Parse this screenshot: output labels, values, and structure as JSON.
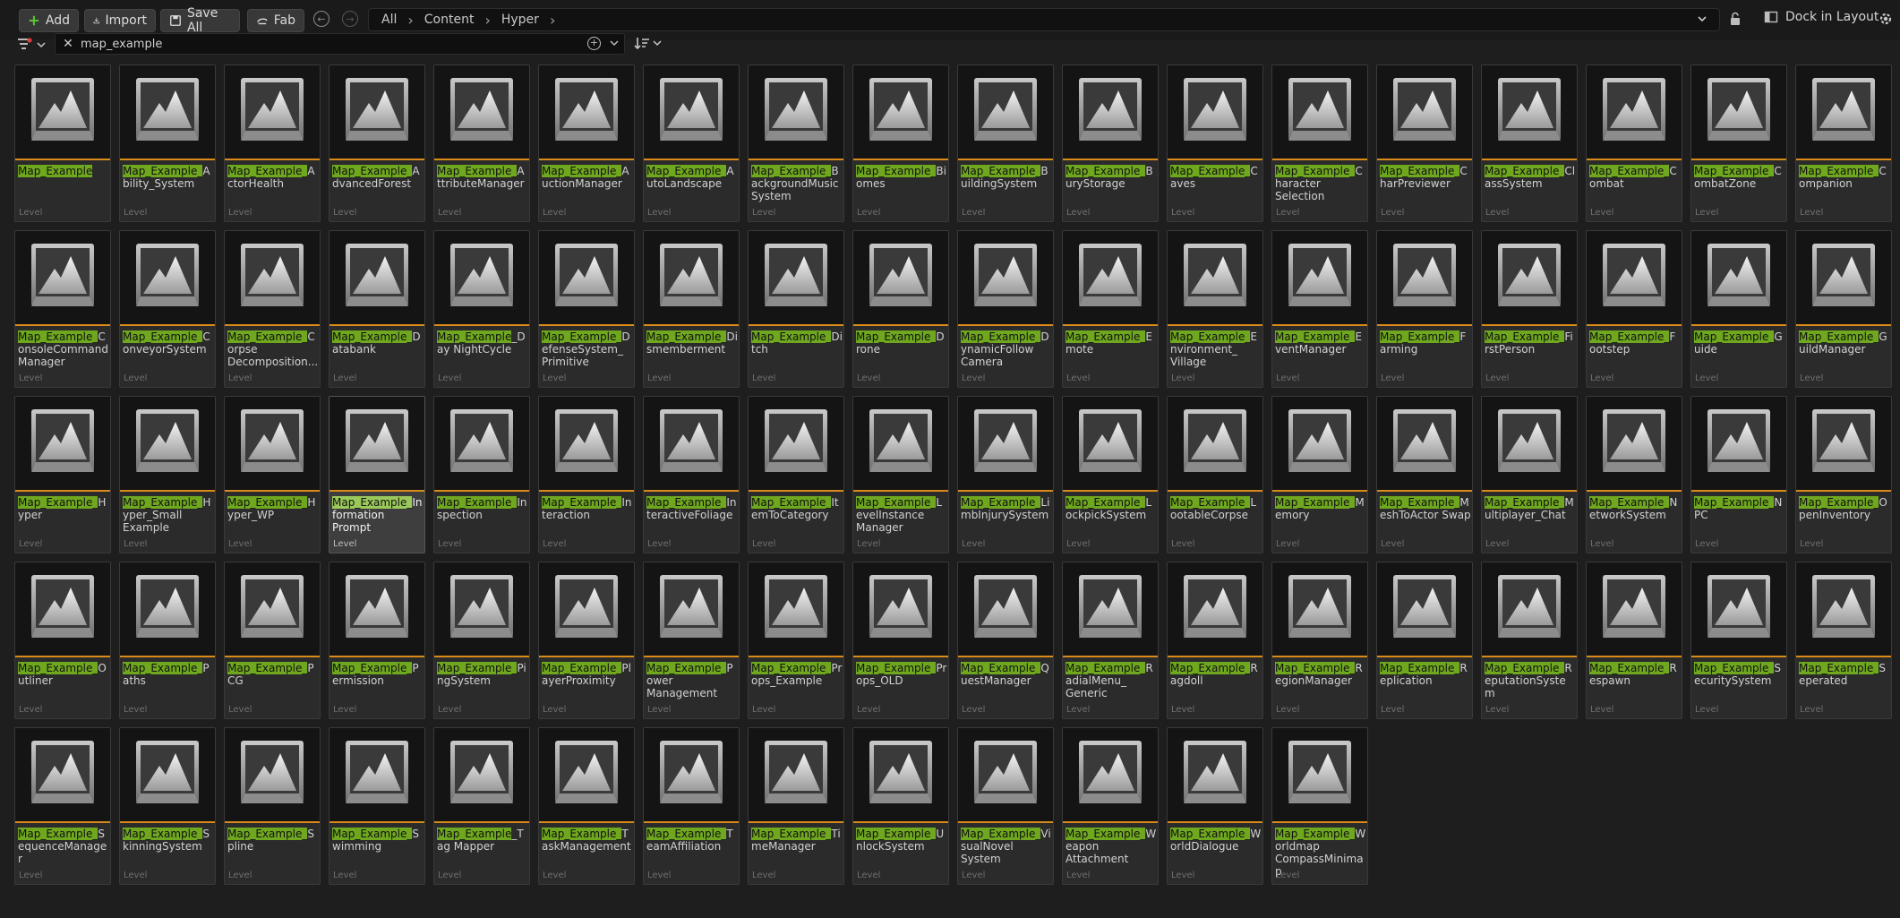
{
  "toolbar": {
    "add_label": "Add",
    "import_label": "Import",
    "save_all_label": "Save All",
    "fab_label": "Fab",
    "dock_label": "Dock in Layout"
  },
  "breadcrumb": [
    "All",
    "Content",
    "Hyper"
  ],
  "search": {
    "value": "map_example"
  },
  "highlight_color": "#6fa81f",
  "thumbnail_underline_color": "#d98a18",
  "assets": [
    {
      "hl": "Map_Example",
      "rest": "",
      "type": "Level"
    },
    {
      "hl": "Map_Example_",
      "rest": "Ability_System",
      "type": "Level"
    },
    {
      "hl": "Map_Example_",
      "rest": "ActorHealth",
      "type": "Level"
    },
    {
      "hl": "Map_Example_",
      "rest": "AdvancedForest",
      "type": "Level"
    },
    {
      "hl": "Map_Example_",
      "rest": "AttributeManager",
      "type": "Level"
    },
    {
      "hl": "Map_Example_",
      "rest": "AuctionManager",
      "type": "Level"
    },
    {
      "hl": "Map_Example_",
      "rest": "AutoLandscape",
      "type": "Level"
    },
    {
      "hl": "Map_Example_",
      "rest": "BackgroundMusic System",
      "type": "Level"
    },
    {
      "hl": "Map_Example_",
      "rest": "Biomes",
      "type": "Level"
    },
    {
      "hl": "Map_Example_",
      "rest": "BuildingSystem",
      "type": "Level"
    },
    {
      "hl": "Map_Example_",
      "rest": "BuryStorage",
      "type": "Level"
    },
    {
      "hl": "Map_Example_",
      "rest": "Caves",
      "type": "Level"
    },
    {
      "hl": "Map_Example_",
      "rest": "Character Selection",
      "type": "Level"
    },
    {
      "hl": "Map_Example_",
      "rest": "CharPreviewer",
      "type": "Level"
    },
    {
      "hl": "Map_Example_",
      "rest": "ClassSystem",
      "type": "Level"
    },
    {
      "hl": "Map_Example_",
      "rest": "Combat",
      "type": "Level"
    },
    {
      "hl": "Map_Example_",
      "rest": "CombatZone",
      "type": "Level"
    },
    {
      "hl": "Map_Example_",
      "rest": "Companion",
      "type": "Level"
    },
    {
      "hl": "Map_Example_",
      "rest": "ConsoleCommand Manager",
      "type": "Level"
    },
    {
      "hl": "Map_Example_",
      "rest": "ConveyorSystem",
      "type": "Level"
    },
    {
      "hl": "Map_Example_",
      "rest": "Corpse Decomposition...",
      "type": "Level"
    },
    {
      "hl": "Map_Example_",
      "rest": "Databank",
      "type": "Level"
    },
    {
      "hl": "Map_Example",
      "rest": "_Day NightCycle",
      "type": "Level"
    },
    {
      "hl": "Map_Example_",
      "rest": "DefenseSystem_ Primitive",
      "type": "Level"
    },
    {
      "hl": "Map_Example_",
      "rest": "Dismemberment",
      "type": "Level"
    },
    {
      "hl": "Map_Example_",
      "rest": "Ditch",
      "type": "Level"
    },
    {
      "hl": "Map_Example_",
      "rest": "Drone",
      "type": "Level"
    },
    {
      "hl": "Map_Example_",
      "rest": "DynamicFollow Camera",
      "type": "Level"
    },
    {
      "hl": "Map_Example_",
      "rest": "Emote",
      "type": "Level"
    },
    {
      "hl": "Map_Example_",
      "rest": "Environment_ Village",
      "type": "Level"
    },
    {
      "hl": "Map_Example_",
      "rest": "EventManager",
      "type": "Level"
    },
    {
      "hl": "Map_Example_",
      "rest": "Farming",
      "type": "Level"
    },
    {
      "hl": "Map_Example_",
      "rest": "FirstPerson",
      "type": "Level"
    },
    {
      "hl": "Map_Example_",
      "rest": "Footstep",
      "type": "Level"
    },
    {
      "hl": "Map_Example_",
      "rest": "Guide",
      "type": "Level"
    },
    {
      "hl": "Map_Example_",
      "rest": "GuildManager",
      "type": "Level"
    },
    {
      "hl": "Map_Example_",
      "rest": "Hyper",
      "type": "Level"
    },
    {
      "hl": "Map_Example_",
      "rest": "Hyper_Small Example",
      "type": "Level"
    },
    {
      "hl": "Map_Example_",
      "rest": "Hyper_WP",
      "type": "Level"
    },
    {
      "hl": "Map_Example_",
      "rest": "Information Prompt",
      "type": "Level",
      "selected": true
    },
    {
      "hl": "Map_Example_",
      "rest": "Inspection",
      "type": "Level"
    },
    {
      "hl": "Map_Example_",
      "rest": "Interaction",
      "type": "Level"
    },
    {
      "hl": "Map_Example_",
      "rest": "InteractiveFoliage",
      "type": "Level"
    },
    {
      "hl": "Map_Example_",
      "rest": "ItemToCategory",
      "type": "Level"
    },
    {
      "hl": "Map_Example_",
      "rest": "LevelInstance Manager",
      "type": "Level"
    },
    {
      "hl": "Map_Example_",
      "rest": "LimbInjurySystem",
      "type": "Level"
    },
    {
      "hl": "Map_Example_",
      "rest": "LockpickSystem",
      "type": "Level"
    },
    {
      "hl": "Map_Example_",
      "rest": "LootableCorpse",
      "type": "Level"
    },
    {
      "hl": "Map_Example_",
      "rest": "Memory",
      "type": "Level"
    },
    {
      "hl": "Map_Example_",
      "rest": "MeshToActor Swap",
      "type": "Level"
    },
    {
      "hl": "Map_Example_",
      "rest": "Multiplayer_Chat",
      "type": "Level"
    },
    {
      "hl": "Map_Example_",
      "rest": "NetworkSystem",
      "type": "Level"
    },
    {
      "hl": "Map_Example_",
      "rest": "NPC",
      "type": "Level"
    },
    {
      "hl": "Map_Example_",
      "rest": "OpenInventory",
      "type": "Level"
    },
    {
      "hl": "Map_Example_",
      "rest": "Outliner",
      "type": "Level"
    },
    {
      "hl": "Map_Example_",
      "rest": "Paths",
      "type": "Level"
    },
    {
      "hl": "Map_Example_",
      "rest": "PCG",
      "type": "Level"
    },
    {
      "hl": "Map_Example_",
      "rest": "Permission",
      "type": "Level"
    },
    {
      "hl": "Map_Example_",
      "rest": "PingSystem",
      "type": "Level"
    },
    {
      "hl": "Map_Example_",
      "rest": "PlayerProximity",
      "type": "Level"
    },
    {
      "hl": "Map_Example_",
      "rest": "Power Management",
      "type": "Level"
    },
    {
      "hl": "Map_Example_",
      "rest": "Props_Example",
      "type": "Level"
    },
    {
      "hl": "Map_Example_",
      "rest": "Props_OLD",
      "type": "Level"
    },
    {
      "hl": "Map_Example_",
      "rest": "QuestManager",
      "type": "Level"
    },
    {
      "hl": "Map_Example_",
      "rest": "RadialMenu_ Generic",
      "type": "Level"
    },
    {
      "hl": "Map_Example_",
      "rest": "Ragdoll",
      "type": "Level"
    },
    {
      "hl": "Map_Example_",
      "rest": "RegionManager",
      "type": "Level"
    },
    {
      "hl": "Map_Example_",
      "rest": "Replication",
      "type": "Level"
    },
    {
      "hl": "Map_Example_",
      "rest": "ReputationSystem",
      "type": "Level"
    },
    {
      "hl": "Map_Example_",
      "rest": "Respawn",
      "type": "Level"
    },
    {
      "hl": "Map_Example_",
      "rest": "SecuritySystem",
      "type": "Level"
    },
    {
      "hl": "Map_Example_",
      "rest": "Seperated",
      "type": "Level"
    },
    {
      "hl": "Map_Example_",
      "rest": "SequenceManager",
      "type": "Level"
    },
    {
      "hl": "Map_Example_",
      "rest": "SkinningSystem",
      "type": "Level"
    },
    {
      "hl": "Map_Example_",
      "rest": "Spline",
      "type": "Level"
    },
    {
      "hl": "Map_Example_",
      "rest": "Swimming",
      "type": "Level"
    },
    {
      "hl": "Map_Example",
      "rest": "_Tag Mapper",
      "type": "Level"
    },
    {
      "hl": "Map_Example_",
      "rest": "TaskManagement",
      "type": "Level"
    },
    {
      "hl": "Map_Example_",
      "rest": "TeamAffiliation",
      "type": "Level"
    },
    {
      "hl": "Map_Example_",
      "rest": "TimeManager",
      "type": "Level"
    },
    {
      "hl": "Map_Example_",
      "rest": "UnlockSystem",
      "type": "Level"
    },
    {
      "hl": "Map_Example_",
      "rest": "VisualNovel System",
      "type": "Level"
    },
    {
      "hl": "Map_Example_",
      "rest": "Weapon Attachment",
      "type": "Level"
    },
    {
      "hl": "Map_Example_",
      "rest": "WorldDialogue",
      "type": "Level"
    },
    {
      "hl": "Map_Example_",
      "rest": "Worldmap CompassMinimap",
      "type": "Level"
    }
  ]
}
